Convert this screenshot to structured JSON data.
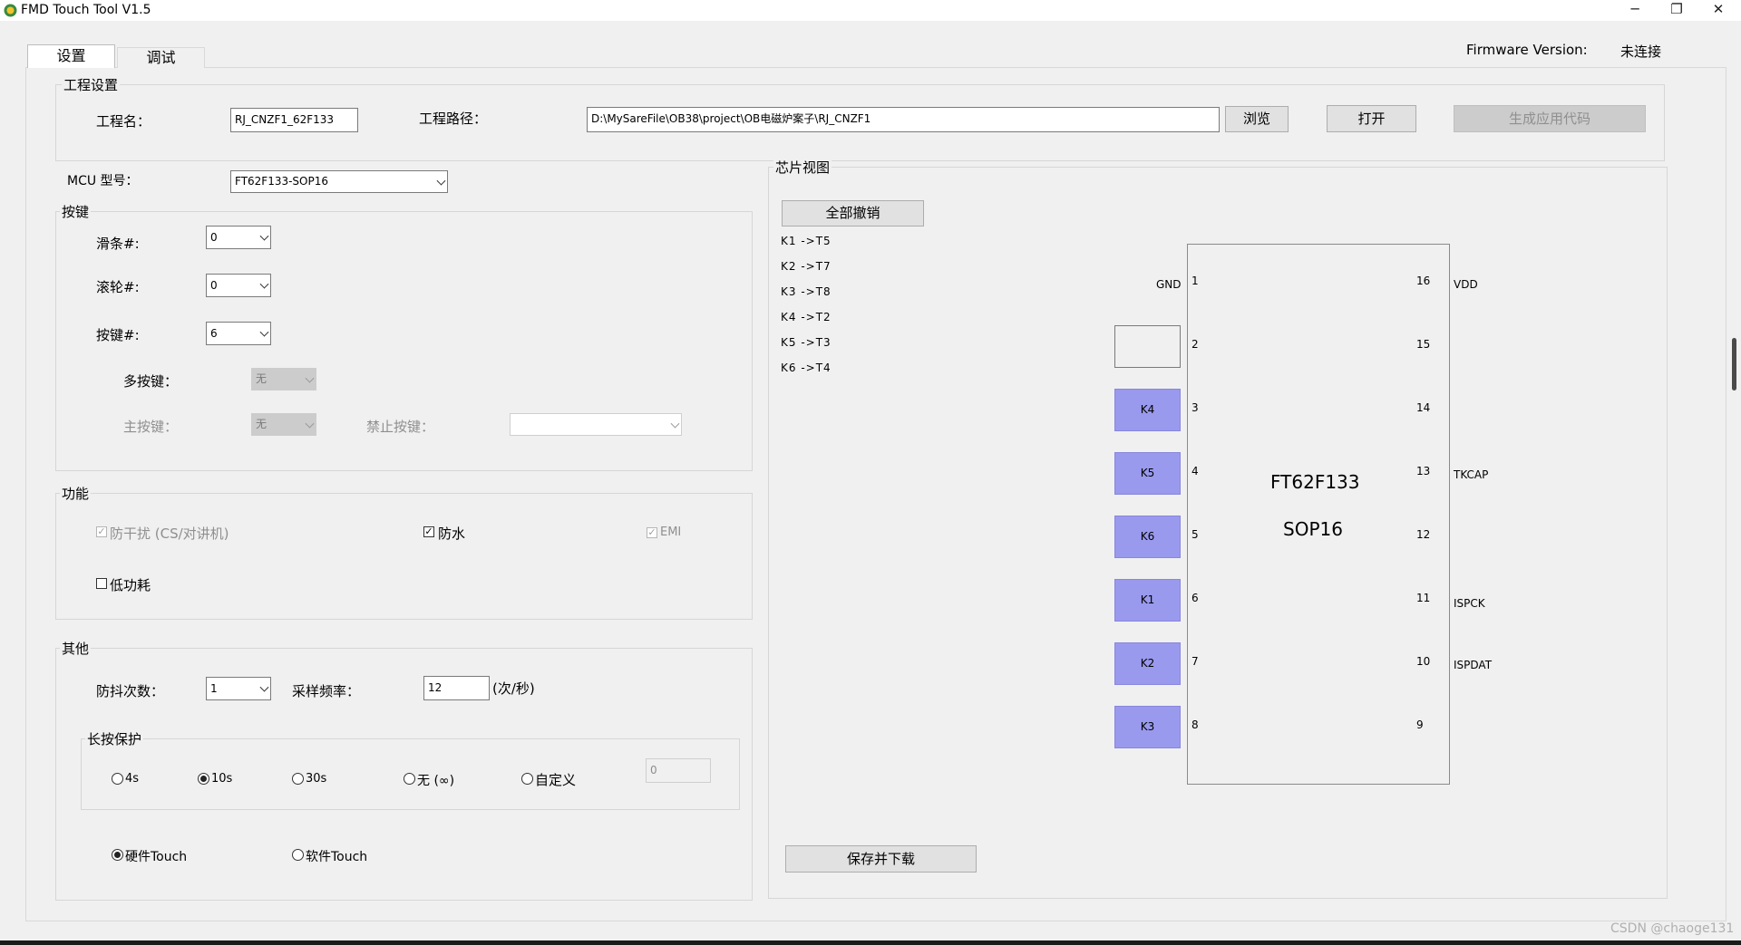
{
  "window": {
    "title": "FMD Touch Tool V1.5",
    "minimize": "─",
    "restore": "❐",
    "close": "✕"
  },
  "tabs": [
    {
      "label": "设置",
      "selected": true
    },
    {
      "label": "调试",
      "selected": false
    }
  ],
  "firmware": {
    "label": "Firmware Version:",
    "value": "未连接"
  },
  "project": {
    "legend": "工程设置",
    "name_label": "工程名：",
    "name_value": "RJ_CNZF1_62F133",
    "path_label": "工程路径：",
    "path_value": "D:\\MySareFile\\OB38\\project\\OB电磁炉案子\\RJ_CNZF1",
    "browse_button": "浏览",
    "open_button": "打开",
    "generate_button": "生成应用代码"
  },
  "mcu": {
    "label": "MCU 型号：",
    "value": "FT62F133-SOP16"
  },
  "keys": {
    "legend": "按键",
    "slider_label": "滑条#:",
    "slider_value": "0",
    "wheel_label": "滚轮#:",
    "wheel_value": "0",
    "key_label": "按键#:",
    "key_value": "6",
    "multikey_label": "多按键：",
    "multikey_value": "无",
    "mainkey_label": "主按键：",
    "mainkey_value": "无",
    "forbid_label": "禁止按键：",
    "forbid_value": ""
  },
  "features": {
    "legend": "功能",
    "anti_interference": "防干扰 (CS/对讲机)",
    "waterproof": "防水",
    "emi": "EMI",
    "low_power": "低功耗",
    "check_mark": "✓"
  },
  "other": {
    "legend": "其他",
    "debounce_label": "防抖次数：",
    "debounce_value": "1",
    "sample_label": "采样频率：",
    "sample_value": "12",
    "sample_unit": "(次/秒)",
    "long_press_legend": "长按保护",
    "long_press_options": [
      "4s",
      "10s",
      "30s",
      "无 (∞)",
      "自定义"
    ],
    "long_press_selected": "10s",
    "custom_value": "0",
    "touch_options": [
      "硬件Touch",
      "软件Touch"
    ],
    "touch_selected": "硬件Touch"
  },
  "chip_view": {
    "legend": "芯片视图",
    "undo_all_button": "全部撤销",
    "mappings": [
      "K1 ->T5",
      "K2 ->T7",
      "K3 ->T8",
      "K4 ->T2",
      "K5 ->T3",
      "K6 ->T4"
    ],
    "chip_name": "FT62F133",
    "chip_package": "SOP16",
    "left_pins": [
      {
        "num": "1",
        "name": "GND",
        "box": ""
      },
      {
        "num": "2",
        "name": "",
        "box": "empty"
      },
      {
        "num": "3",
        "name": "",
        "box": "K4"
      },
      {
        "num": "4",
        "name": "",
        "box": "K5"
      },
      {
        "num": "5",
        "name": "",
        "box": "K6"
      },
      {
        "num": "6",
        "name": "",
        "box": "K1"
      },
      {
        "num": "7",
        "name": "",
        "box": "K2"
      },
      {
        "num": "8",
        "name": "",
        "box": "K3"
      }
    ],
    "right_pins": [
      {
        "num": "16",
        "name": "VDD"
      },
      {
        "num": "15",
        "name": ""
      },
      {
        "num": "14",
        "name": ""
      },
      {
        "num": "13",
        "name": "TKCAP"
      },
      {
        "num": "12",
        "name": ""
      },
      {
        "num": "11",
        "name": "ISPCK"
      },
      {
        "num": "10",
        "name": "ISPDAT"
      },
      {
        "num": "9",
        "name": ""
      }
    ],
    "save_download_button": "保存并下载"
  },
  "watermark": "CSDN @chaoge131",
  "colors": {
    "key_pin": "#9999ee",
    "background": "#f0f0f0"
  }
}
